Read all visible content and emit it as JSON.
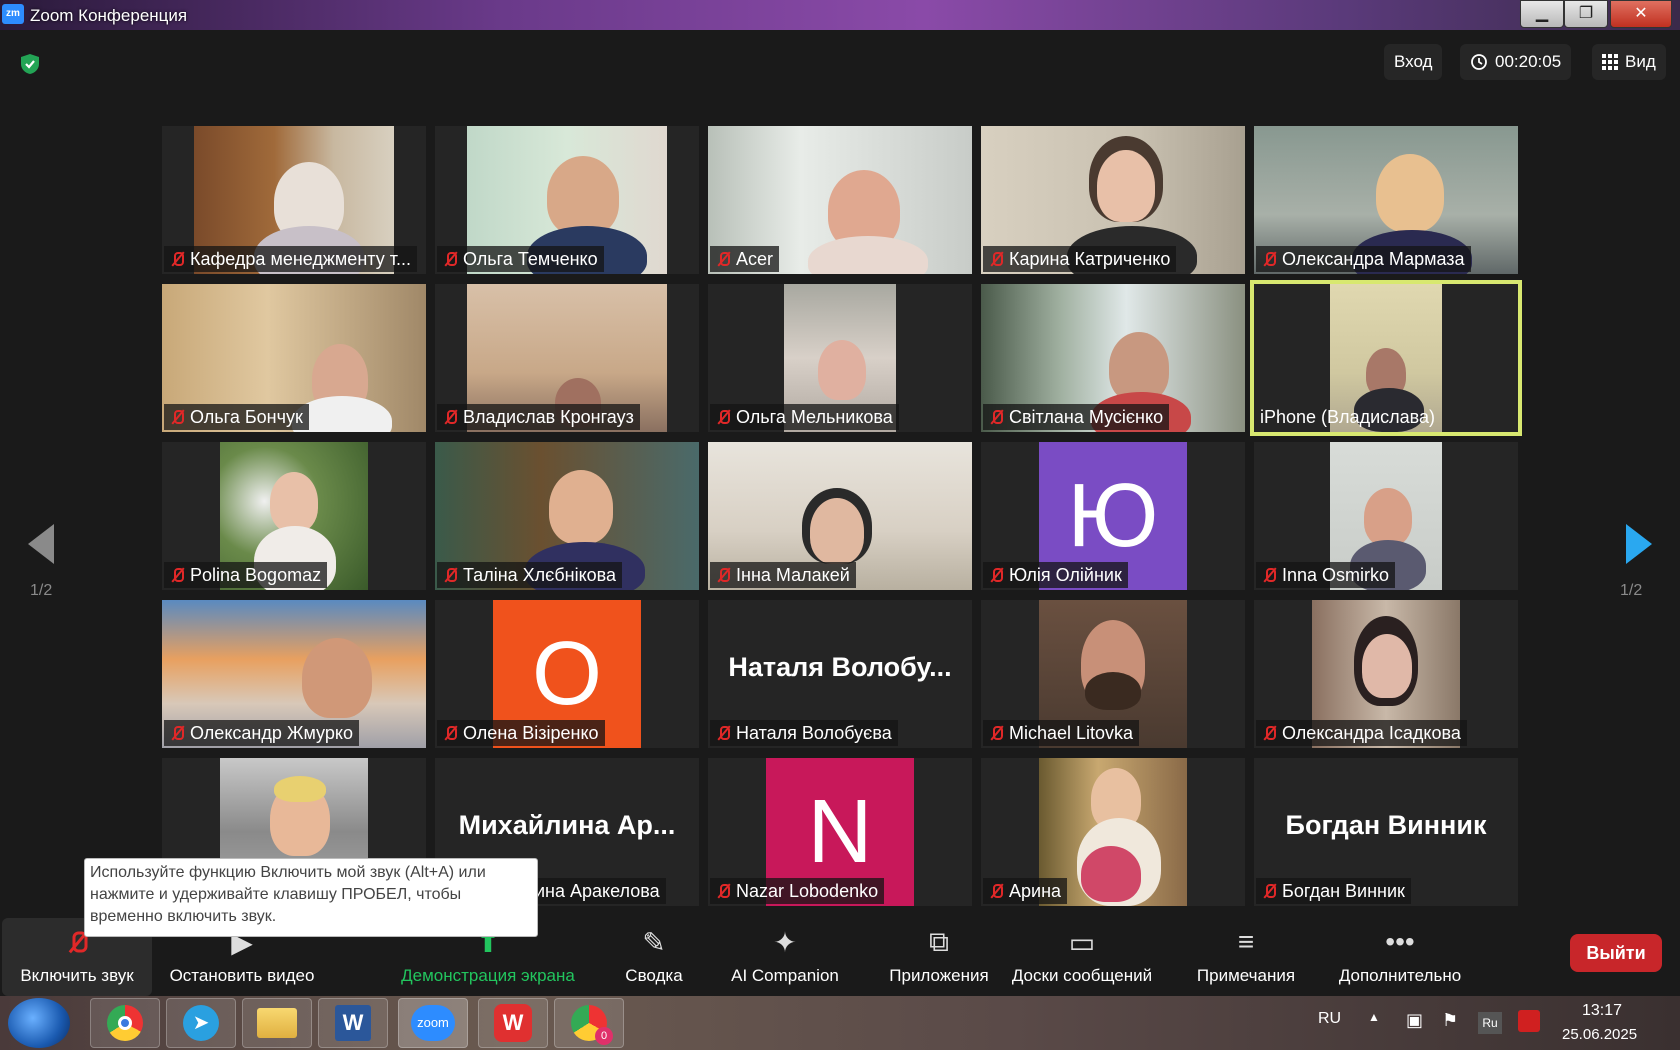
{
  "window": {
    "title": "Zoom Конференция",
    "min": "▁",
    "max": "❐",
    "close": "✕"
  },
  "topbar": {
    "login": "Вход",
    "timer": "00:20:05",
    "view": "Вид"
  },
  "pagination": {
    "left": "1/2",
    "right": "1/2"
  },
  "participants": [
    {
      "name": "Кафедра менеджменту т...",
      "muted": true
    },
    {
      "name": "Ольга Темченко",
      "muted": true
    },
    {
      "name": "Acer",
      "muted": true
    },
    {
      "name": "Карина Катриченко",
      "muted": true
    },
    {
      "name": "Олександра Мармаза",
      "muted": true
    },
    {
      "name": "Ольга Бончук",
      "muted": true
    },
    {
      "name": "Владислав Кронгауз",
      "muted": true
    },
    {
      "name": "Ольга Мельникова",
      "muted": true
    },
    {
      "name": "Світлана Мусієнко",
      "muted": true
    },
    {
      "name": "iPhone (Владислава)",
      "muted": false,
      "active_speaker": true
    },
    {
      "name": "Polina Bogomaz",
      "muted": true
    },
    {
      "name": "Таліна Хлєбнікова",
      "muted": true
    },
    {
      "name": "Інна Малакей",
      "muted": true
    },
    {
      "name": "Юлія Олійник",
      "muted": true,
      "avatar_letter": "Ю",
      "avatar_color": "#7a4cc4"
    },
    {
      "name": "Inna Osmirko",
      "muted": true
    },
    {
      "name": "Олександр Жмурко",
      "muted": true
    },
    {
      "name": "Олена Візіренко",
      "muted": true,
      "avatar_letter": "O",
      "avatar_color": "#f0521c"
    },
    {
      "name": "Наталя Волобуєва",
      "muted": true,
      "big_name": "Наталя Волобу..."
    },
    {
      "name": "Michael Litovka",
      "muted": true
    },
    {
      "name": "Олександра Ісадкова",
      "muted": true
    },
    {
      "name": "",
      "muted": false
    },
    {
      "name": "ина Аракелова",
      "muted": false,
      "big_name": "Михайлина Ар..."
    },
    {
      "name": "Nazar Lobodenko",
      "muted": true,
      "avatar_letter": "N",
      "avatar_color": "#c8185a"
    },
    {
      "name": "Арина",
      "muted": true
    },
    {
      "name": "Богдан Винник",
      "muted": true,
      "big_name": "Богдан Винник"
    }
  ],
  "tooltip": {
    "text": "Используйте функцию Включить мой звук (Alt+A) или нажмите и удерживайте клавишу ПРОБЕЛ, чтобы временно включить звук."
  },
  "toolbar": {
    "unmute": "Включить звук",
    "video": "Остановить видео",
    "share": "Демонстрация экрана",
    "summary": "Сводка",
    "ai": "AI Companion",
    "apps": "Приложения",
    "boards": "Доски сообщений",
    "notes": "Примечания",
    "more": "Дополнительно",
    "leave": "Выйти"
  },
  "taskbar": {
    "lang": "RU",
    "lang_badge": "Ru",
    "time": "13:17",
    "date": "25.06.2025",
    "zoom_label": "zoom",
    "chrome_badge": "0"
  },
  "colors": {
    "share_green": "#22c55e",
    "leave_red": "#c8262a",
    "active_outline": "#d8e870",
    "mute_red": "#e02828",
    "nav_blue": "#2aa8f0"
  }
}
